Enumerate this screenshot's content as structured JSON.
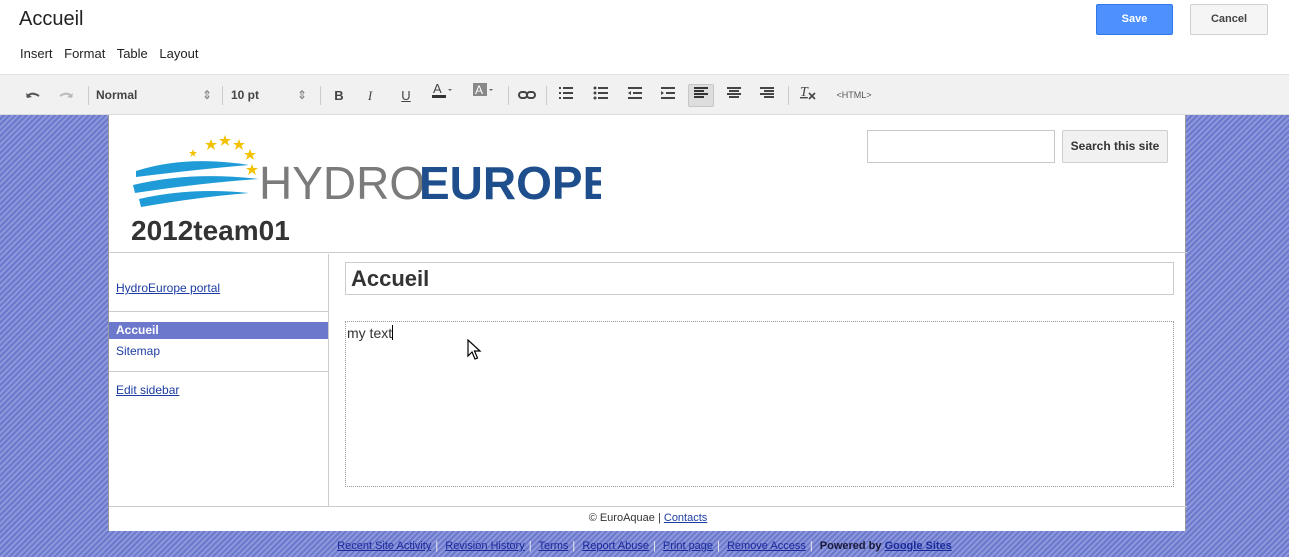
{
  "editor": {
    "page_title": "Accueil",
    "save_label": "Save",
    "cancel_label": "Cancel",
    "menu": [
      "Insert",
      "Format",
      "Table",
      "Layout"
    ]
  },
  "toolbar": {
    "style_value": "Normal",
    "font_size_value": "10 pt",
    "bold_label": "B",
    "italic_label": "I",
    "underline_label": "U",
    "html_label": "<HTML>"
  },
  "site": {
    "logo_text_light": "HYDRO",
    "logo_text_bold": "EUROPE",
    "name": "2012team01",
    "search_placeholder": "",
    "search_button": "Search this site"
  },
  "sidebar": {
    "portal_link": "HydroEurope portal",
    "items": [
      "Accueil",
      "Sitemap"
    ],
    "edit_link": "Edit sidebar"
  },
  "main": {
    "title": "Accueil",
    "content": "my text"
  },
  "footer": {
    "copyright": "© EuroAquae | ",
    "contacts": "Contacts"
  },
  "bottom_links": {
    "links": [
      "Recent Site Activity",
      "Revision History",
      "Terms",
      "Report Abuse",
      "Print page",
      "Remove Access"
    ],
    "powered_prefix": "Powered by ",
    "powered_link": "Google Sites"
  },
  "colors": {
    "accent": "#4d90fe",
    "selected": "#6b78cc",
    "link": "#1c3ca3"
  }
}
